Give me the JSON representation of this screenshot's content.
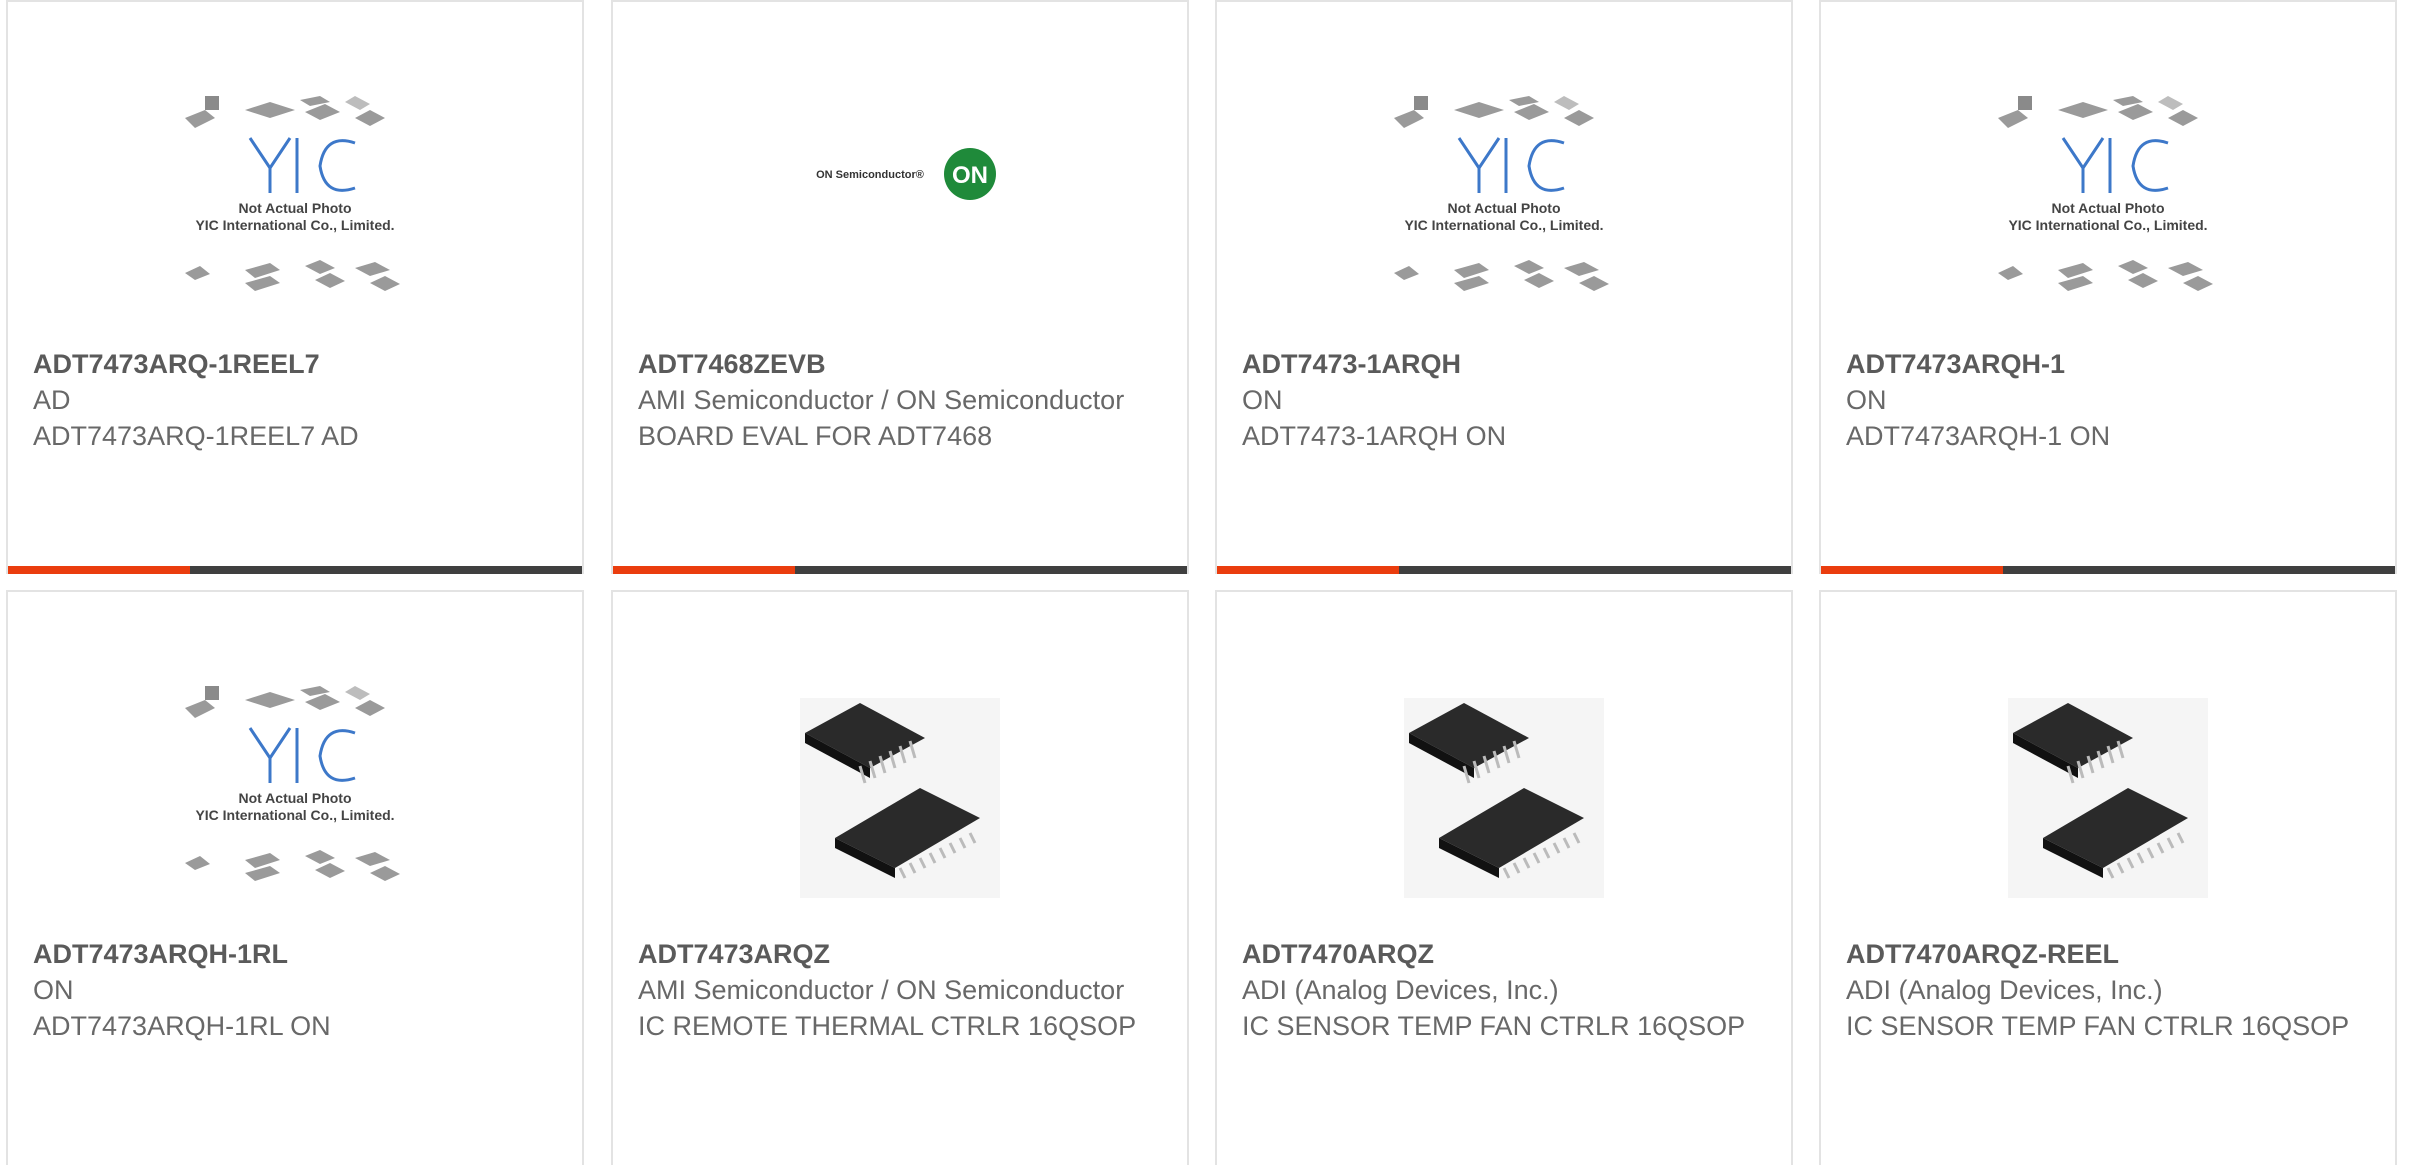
{
  "products": [
    {
      "part": "ADT7473ARQ-1REEL7",
      "maker": "AD",
      "desc": "ADT7473ARQ-1REEL7 AD",
      "image": "not-actual-photo",
      "photo_text": [
        "Not Actual Photo",
        "YIC International Co., Limited."
      ]
    },
    {
      "part": "ADT7468ZEVB",
      "maker": "AMI Semiconductor / ON Semiconductor",
      "desc": "BOARD EVAL FOR ADT7468",
      "image": "on-semiconductor-logo",
      "logo_text": "ON Semiconductor®",
      "logo_badge": "ON"
    },
    {
      "part": "ADT7473-1ARQH",
      "maker": "ON",
      "desc": "ADT7473-1ARQH ON",
      "image": "not-actual-photo",
      "photo_text": [
        "Not Actual Photo",
        "YIC International Co., Limited."
      ]
    },
    {
      "part": "ADT7473ARQH-1",
      "maker": "ON",
      "desc": "ADT7473ARQH-1 ON",
      "image": "not-actual-photo",
      "photo_text": [
        "Not Actual Photo",
        "YIC International Co., Limited."
      ]
    },
    {
      "part": "ADT7473ARQH-1RL",
      "maker": "ON",
      "desc": "ADT7473ARQH-1RL ON",
      "image": "not-actual-photo",
      "photo_text": [
        "Not Actual Photo",
        "YIC International Co., Limited."
      ]
    },
    {
      "part": "ADT7473ARQZ",
      "maker": "AMI Semiconductor / ON Semiconductor",
      "desc": "IC REMOTE THERMAL CTRLR 16QSOP",
      "image": "qsop-chip-photo"
    },
    {
      "part": "ADT7470ARQZ",
      "maker": "ADI (Analog Devices, Inc.)",
      "desc": "IC SENSOR TEMP FAN CTRLR 16QSOP",
      "image": "qsop-chip-photo"
    },
    {
      "part": "ADT7470ARQZ-REEL",
      "maker": "ADI (Analog Devices, Inc.)",
      "desc": "IC SENSOR TEMP FAN CTRLR 16QSOP",
      "image": "qsop-chip-photo"
    }
  ],
  "colors": {
    "accent": "#ea3d0e",
    "bar": "#3f3f3f",
    "text": "#686868",
    "border": "#e3e3e3"
  }
}
